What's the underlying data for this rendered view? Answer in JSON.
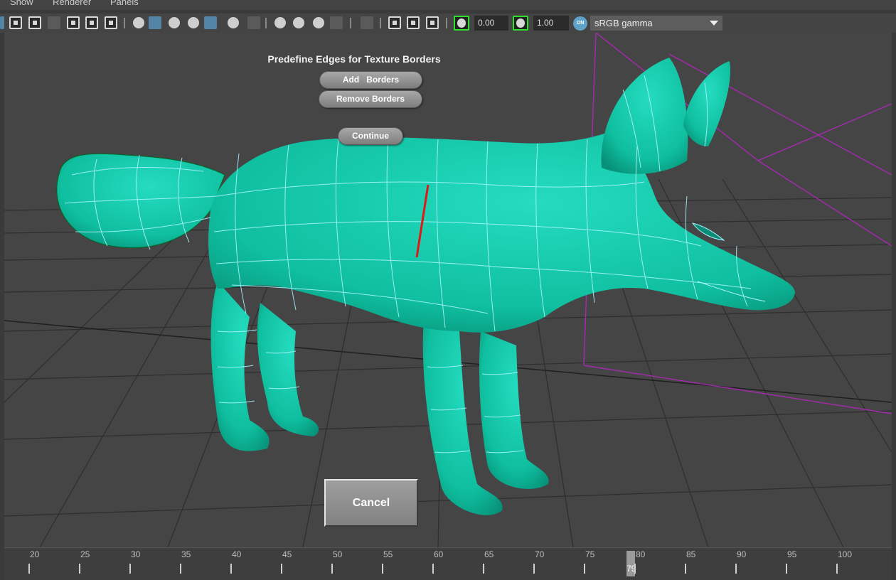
{
  "menubar": {
    "items": [
      "Show",
      "Renderer",
      "Panels"
    ]
  },
  "toolbar": {
    "exposure_value": "0.00",
    "gamma_value": "1.00",
    "color_mgmt_on_label": "ON",
    "color_space": "sRGB gamma"
  },
  "overlay": {
    "title": "Predefine Edges for Texture Borders",
    "add_borders": "Add   Borders",
    "remove_borders": "Remove Borders",
    "continue": "Continue",
    "cancel": "Cancel"
  },
  "timeline": {
    "labels": [
      "20",
      "25",
      "30",
      "35",
      "40",
      "45",
      "50",
      "55",
      "60",
      "65",
      "70",
      "75",
      "80",
      "85",
      "90",
      "95",
      "100"
    ],
    "current_frame": "79"
  },
  "colors": {
    "mesh": "#12c6aa",
    "wire": "#a8f3ff",
    "selected_edge": "#e01818",
    "bounding_box": "#a52ab0",
    "grid": "#2e2e2e"
  }
}
